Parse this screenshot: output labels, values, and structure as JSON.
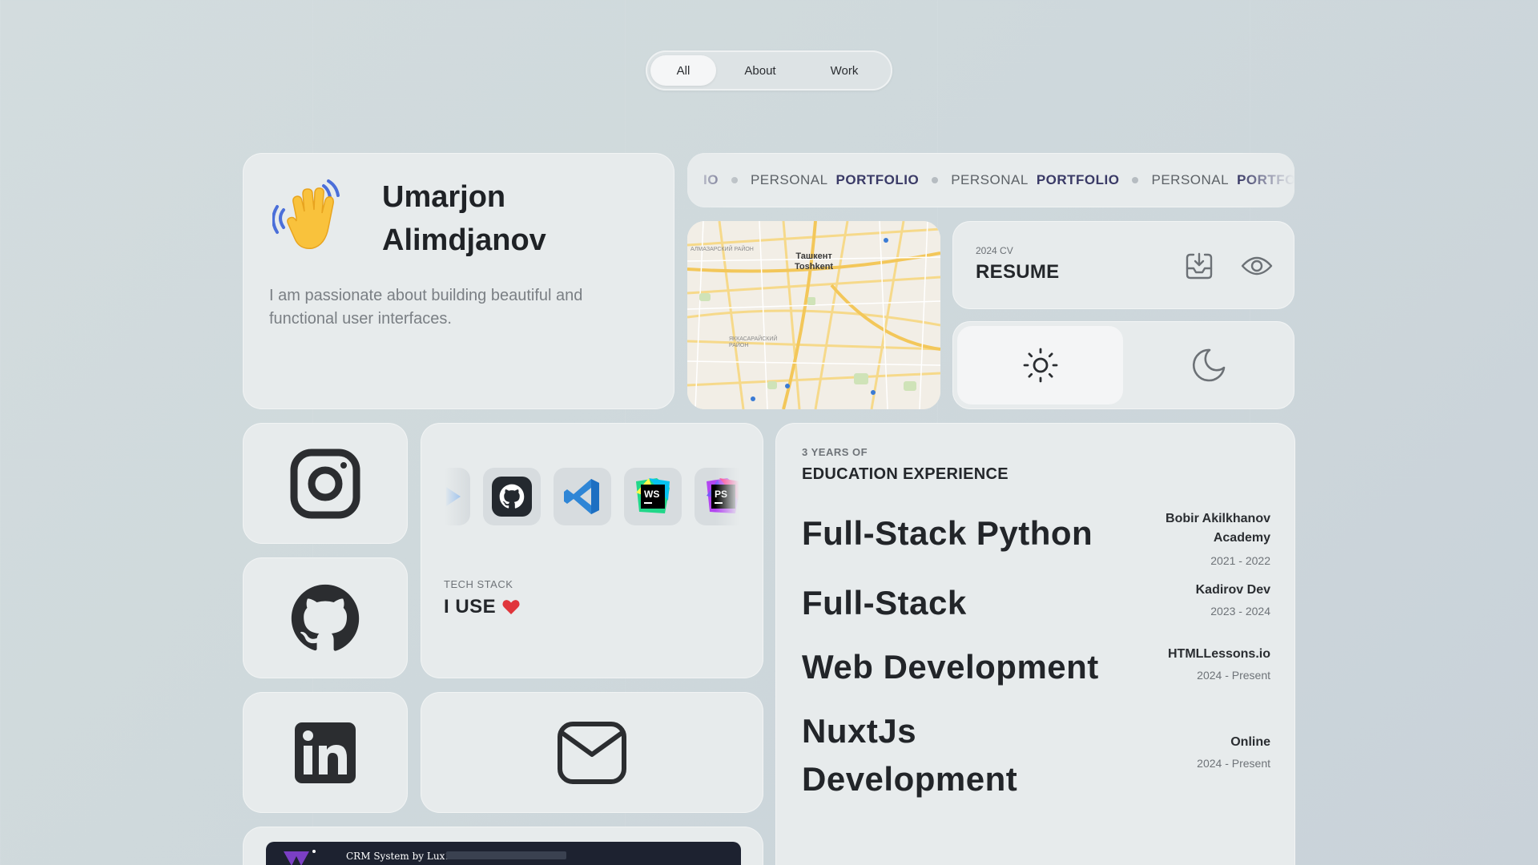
{
  "tabs": [
    {
      "label": "All",
      "active": true
    },
    {
      "label": "About",
      "active": false
    },
    {
      "label": "Work",
      "active": false
    }
  ],
  "profile": {
    "first_name": "Umarjon",
    "last_name": "Alimdjanov",
    "bio": "I am passionate about building beautiful and functional user interfaces.",
    "emoji": "waving-hand"
  },
  "marquee": {
    "partial_start": "IO",
    "word_1": "PERSONAL",
    "word_2": "PORTFOLIO"
  },
  "map": {
    "city_ru": "Ташкент",
    "city_uz": "Toshkent",
    "district_1": "АЛМАЗАРСКИЙ РАЙОН",
    "district_2": "ЯККАСАРАЙСКИЙ РАЙОН"
  },
  "resume": {
    "year_label": "2024 CV",
    "title": "RESUME"
  },
  "theme": {
    "options": [
      "light",
      "dark"
    ],
    "selected": "light"
  },
  "social": [
    "instagram",
    "github",
    "linkedin",
    "email"
  ],
  "tech_stack": {
    "small_label": "TECH STACK",
    "big_label": "I USE",
    "icons": [
      "partial-blue-icon",
      "github",
      "vscode",
      "webstorm",
      "phpstorm"
    ]
  },
  "education": {
    "small_label": "3 YEARS OF",
    "title": "EDUCATION EXPERIENCE",
    "entries": [
      {
        "course": "Full-Stack Python",
        "school": "Bobir Akilkhanov Academy",
        "years": "2021 - 2022"
      },
      {
        "course": "Full-Stack",
        "school": "Kadirov Dev",
        "years": "2023 - 2024"
      },
      {
        "course": "Web Development",
        "school": "HTMLLessons.io",
        "years": "2024 - Present"
      },
      {
        "course": "NuxtJs Development",
        "school": "Online",
        "years": "2024 - Present"
      }
    ]
  },
  "project": {
    "name": "CRM System by Lux1177"
  },
  "colors": {
    "background": "#cfd9dc",
    "card": "#e7ebec",
    "accent_heart": "#e0353b",
    "portfolio_text": "#3a3a66"
  }
}
